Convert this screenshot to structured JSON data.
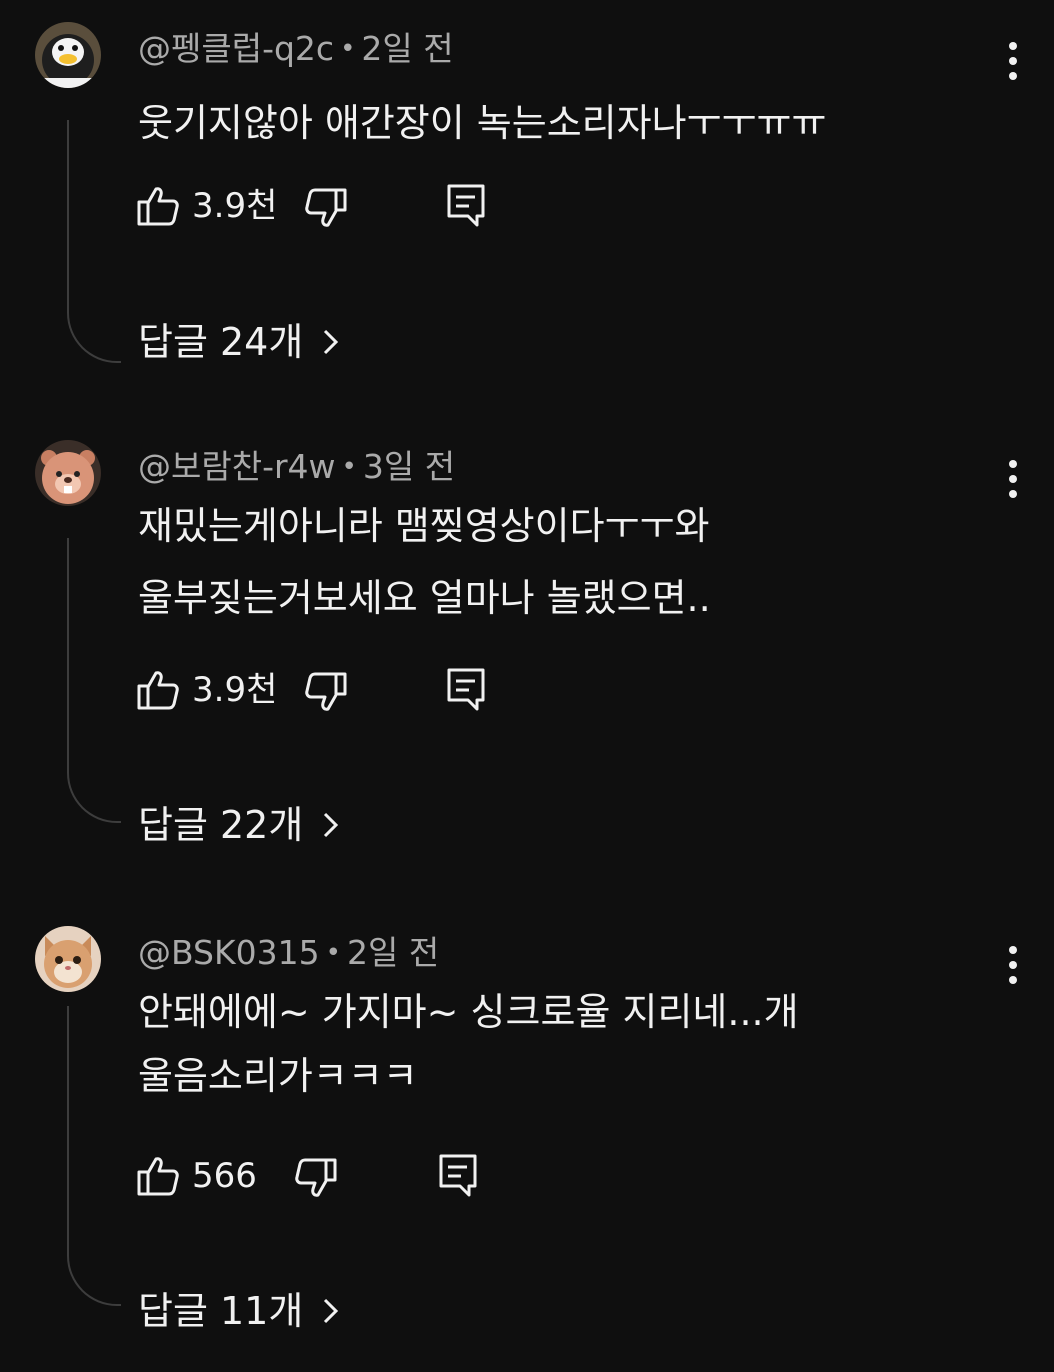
{
  "comments": [
    {
      "author": "@펭클럽-q2c",
      "time": "2일 전",
      "separator": "•",
      "text": "웃기지않아 애간장이 녹는소리자나ㅜㅜㅠㅠ",
      "likes": "3.9천",
      "replies_label": "답글 24개",
      "avatar_icon": "penguin-avatar-icon"
    },
    {
      "author": "@보람찬-r4w",
      "time": "3일 전",
      "separator": "•",
      "text": "재밌는게아니라 맴찢영상이다ㅜㅜ와\n울부짖는거보세요 얼마나 놀랬으면..",
      "likes": "3.9천",
      "replies_label": "답글 22개",
      "avatar_icon": "beaver-avatar-icon"
    },
    {
      "author": "@BSK0315",
      "time": "2일 전",
      "separator": "•",
      "text": "안돼에에~ 가지마~ 싱크로율 지리네...개\n울음소리가ㅋㅋㅋ",
      "likes": "566",
      "replies_label": "답글 11개",
      "avatar_icon": "cat-avatar-icon"
    }
  ],
  "colors": {
    "background": "#0f0f0f",
    "text_primary": "#f1f1f1",
    "text_secondary": "#aaaaaa",
    "thread_line": "#3d3d3d"
  }
}
